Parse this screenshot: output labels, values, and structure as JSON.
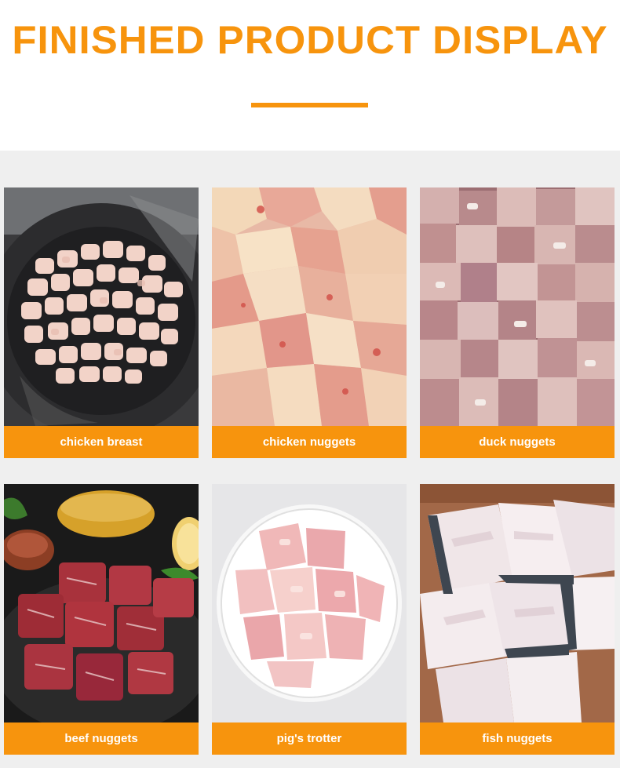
{
  "header": {
    "title": "FINISHED PRODUCT DISPLAY",
    "accent_color": "#f7940d"
  },
  "products": [
    {
      "label": "chicken breast",
      "image": "diced chicken breast in dark bowl"
    },
    {
      "label": "chicken nuggets",
      "image": "raw chicken chunks"
    },
    {
      "label": "duck nuggets",
      "image": "raw duck chunks with bone"
    },
    {
      "label": "beef nuggets",
      "image": "beef cubes on dark plate"
    },
    {
      "label": "pig's trotter",
      "image": "pork trotter pieces on white plate"
    },
    {
      "label": "fish nuggets",
      "image": "white fish fillet pieces"
    }
  ]
}
